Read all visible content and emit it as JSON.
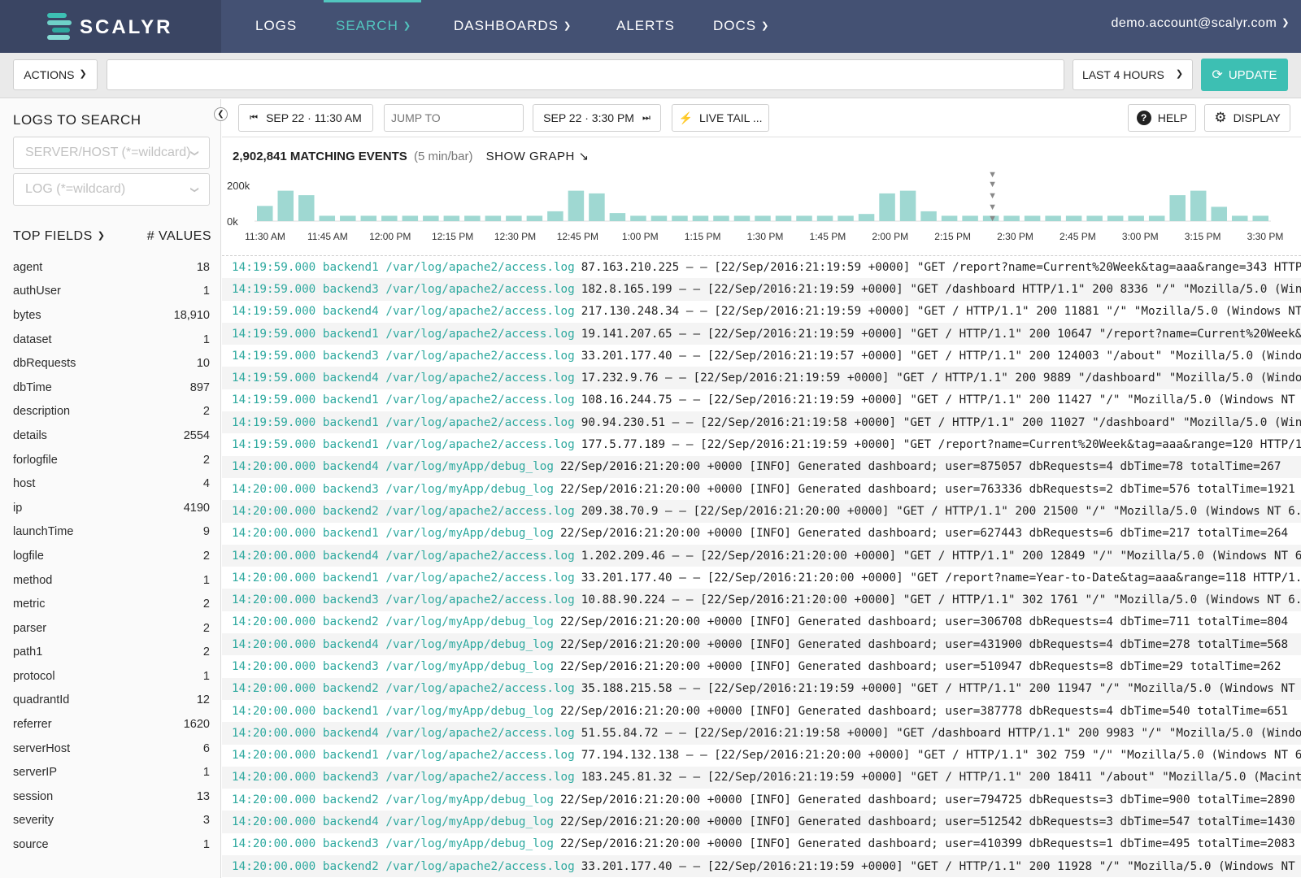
{
  "app": {
    "logo_text": "SCALYR",
    "logo_colors": [
      "#3dbfb3",
      "#6fd1c8",
      "#2ea99f",
      "#85dbd3"
    ]
  },
  "nav": {
    "items": [
      {
        "label": "LOGS",
        "active": false,
        "dropdown": false
      },
      {
        "label": "SEARCH",
        "active": true,
        "dropdown": true
      },
      {
        "label": "DASHBOARDS",
        "active": false,
        "dropdown": true
      },
      {
        "label": "ALERTS",
        "active": false,
        "dropdown": false
      },
      {
        "label": "DOCS",
        "active": false,
        "dropdown": true
      }
    ],
    "user": "demo.account@scalyr.com"
  },
  "actionbar": {
    "actions_label": "ACTIONS",
    "search_value": "",
    "time_range": "LAST 4 HOURS",
    "update_label": "UPDATE"
  },
  "sidebar": {
    "title": "LOGS TO SEARCH",
    "server_placeholder": "SERVER/HOST (*=wildcard)",
    "log_placeholder": "LOG (*=wildcard)",
    "top_fields_label": "TOP FIELDS",
    "values_label": "# VALUES",
    "fields": [
      {
        "name": "agent",
        "count": "18"
      },
      {
        "name": "authUser",
        "count": "1"
      },
      {
        "name": "bytes",
        "count": "18,910"
      },
      {
        "name": "dataset",
        "count": "1"
      },
      {
        "name": "dbRequests",
        "count": "10"
      },
      {
        "name": "dbTime",
        "count": "897"
      },
      {
        "name": "description",
        "count": "2"
      },
      {
        "name": "details",
        "count": "2554"
      },
      {
        "name": "forlogfile",
        "count": "2"
      },
      {
        "name": "host",
        "count": "4"
      },
      {
        "name": "ip",
        "count": "4190"
      },
      {
        "name": "launchTime",
        "count": "9"
      },
      {
        "name": "logfile",
        "count": "2"
      },
      {
        "name": "method",
        "count": "1"
      },
      {
        "name": "metric",
        "count": "2"
      },
      {
        "name": "parser",
        "count": "2"
      },
      {
        "name": "path1",
        "count": "2"
      },
      {
        "name": "protocol",
        "count": "1"
      },
      {
        "name": "quadrantId",
        "count": "12"
      },
      {
        "name": "referrer",
        "count": "1620"
      },
      {
        "name": "serverHost",
        "count": "6"
      },
      {
        "name": "serverIP",
        "count": "1"
      },
      {
        "name": "session",
        "count": "13"
      },
      {
        "name": "severity",
        "count": "3"
      },
      {
        "name": "source",
        "count": "1"
      }
    ]
  },
  "toolbar": {
    "start_time": "SEP 22 · 11:30 AM",
    "jump_placeholder": "JUMP TO",
    "end_time": "SEP 22 · 3:30 PM",
    "live_tail": "LIVE TAIL ...",
    "help": "HELP",
    "display": "DISPLAY"
  },
  "summary": {
    "matching": "2,902,841 MATCHING EVENTS",
    "rate": "(5 min/bar)",
    "show_graph": "SHOW GRAPH ↘"
  },
  "chart_data": {
    "type": "bar",
    "ylabel_ticks": [
      "200k",
      "0k"
    ],
    "ylim": [
      0,
      200000
    ],
    "x_tick_labels": [
      "11:30 AM",
      "11:45 AM",
      "12:00 PM",
      "12:15 PM",
      "12:30 PM",
      "12:45 PM",
      "1:00 PM",
      "1:15 PM",
      "1:30 PM",
      "1:45 PM",
      "2:00 PM",
      "2:15 PM",
      "2:30 PM",
      "2:45 PM",
      "3:00 PM",
      "3:15 PM",
      "3:30 PM"
    ],
    "bar_color": "#9fd8d2",
    "values": [
      85000,
      170000,
      145000,
      30000,
      30000,
      30000,
      30000,
      30000,
      30000,
      30000,
      30000,
      30000,
      30000,
      30000,
      55000,
      170000,
      155000,
      45000,
      30000,
      30000,
      30000,
      30000,
      30000,
      30000,
      30000,
      30000,
      30000,
      30000,
      30000,
      40000,
      155000,
      170000,
      55000,
      30000,
      30000,
      30000,
      30000,
      30000,
      30000,
      30000,
      30000,
      30000,
      30000,
      30000,
      145000,
      170000,
      80000,
      30000,
      30000
    ]
  },
  "logs": [
    {
      "prefix": "14:19:59.000 backend1 /var/log/apache2/access.log",
      "msg": "87.163.210.225 – – [22/Sep/2016:21:19:59 +0000] \"GET /report?name=Current%20Week&tag=aaa&range=343 HTTP/"
    },
    {
      "prefix": "14:19:59.000 backend3 /var/log/apache2/access.log",
      "msg": "182.8.165.199 – – [22/Sep/2016:21:19:59 +0000] \"GET /dashboard HTTP/1.1\" 200 8336 \"/\" \"Mozilla/5.0 (Wind"
    },
    {
      "prefix": "14:19:59.000 backend4 /var/log/apache2/access.log",
      "msg": "217.130.248.34 – – [22/Sep/2016:21:19:59 +0000] \"GET / HTTP/1.1\" 200 11881 \"/\" \"Mozilla/5.0 (Windows NT"
    },
    {
      "prefix": "14:19:59.000 backend1 /var/log/apache2/access.log",
      "msg": "19.141.207.65 – – [22/Sep/2016:21:19:59 +0000] \"GET / HTTP/1.1\" 200 10647 \"/report?name=Current%20Week&t"
    },
    {
      "prefix": "14:19:59.000 backend3 /var/log/apache2/access.log",
      "msg": "33.201.177.40 – – [22/Sep/2016:21:19:57 +0000] \"GET / HTTP/1.1\" 200 124003 \"/about\" \"Mozilla/5.0 (Windo"
    },
    {
      "prefix": "14:19:59.000 backend4 /var/log/apache2/access.log",
      "msg": "17.232.9.76 – – [22/Sep/2016:21:19:59 +0000] \"GET / HTTP/1.1\" 200 9889 \"/dashboard\" \"Mozilla/5.0 (Windo"
    },
    {
      "prefix": "14:19:59.000 backend1 /var/log/apache2/access.log",
      "msg": "108.16.244.75 – – [22/Sep/2016:21:19:59 +0000] \"GET / HTTP/1.1\" 200 11427 \"/\" \"Mozilla/5.0 (Windows NT 6"
    },
    {
      "prefix": "14:19:59.000 backend1 /var/log/apache2/access.log",
      "msg": "90.94.230.51 – – [22/Sep/2016:21:19:58 +0000] \"GET / HTTP/1.1\" 200 11027 \"/dashboard\" \"Mozilla/5.0 (Win"
    },
    {
      "prefix": "14:19:59.000 backend1 /var/log/apache2/access.log",
      "msg": "177.5.77.189 – – [22/Sep/2016:21:19:59 +0000] \"GET /report?name=Current%20Week&tag=aaa&range=120 HTTP/1."
    },
    {
      "prefix": "14:20:00.000 backend4 /var/log/myApp/debug_log",
      "msg": "22/Sep/2016:21:20:00 +0000 [INFO] Generated dashboard; user=875057 dbRequests=4 dbTime=78 totalTime=267"
    },
    {
      "prefix": "14:20:00.000 backend3 /var/log/myApp/debug_log",
      "msg": "22/Sep/2016:21:20:00 +0000 [INFO] Generated dashboard; user=763336 dbRequests=2 dbTime=576 totalTime=1921"
    },
    {
      "prefix": "14:20:00.000 backend2 /var/log/apache2/access.log",
      "msg": "209.38.70.9 – – [22/Sep/2016:21:20:00 +0000] \"GET / HTTP/1.1\" 200 21500 \"/\" \"Mozilla/5.0 (Windows NT 6.1"
    },
    {
      "prefix": "14:20:00.000 backend1 /var/log/myApp/debug_log",
      "msg": "22/Sep/2016:21:20:00 +0000 [INFO] Generated dashboard; user=627443 dbRequests=6 dbTime=217 totalTime=264"
    },
    {
      "prefix": "14:20:00.000 backend4 /var/log/apache2/access.log",
      "msg": "1.202.209.46 – – [22/Sep/2016:21:20:00 +0000] \"GET / HTTP/1.1\" 200 12849 \"/\" \"Mozilla/5.0 (Windows NT 6."
    },
    {
      "prefix": "14:20:00.000 backend1 /var/log/apache2/access.log",
      "msg": "33.201.177.40 – – [22/Sep/2016:21:20:00 +0000] \"GET /report?name=Year-to-Date&tag=aaa&range=118 HTTP/1.1"
    },
    {
      "prefix": "14:20:00.000 backend3 /var/log/apache2/access.log",
      "msg": "10.88.90.224 – – [22/Sep/2016:21:20:00 +0000] \"GET / HTTP/1.1\" 302 1761 \"/\" \"Mozilla/5.0 (Windows NT 6.1"
    },
    {
      "prefix": "14:20:00.000 backend2 /var/log/myApp/debug_log",
      "msg": "22/Sep/2016:21:20:00 +0000 [INFO] Generated dashboard; user=306708 dbRequests=4 dbTime=711 totalTime=804"
    },
    {
      "prefix": "14:20:00.000 backend4 /var/log/myApp/debug_log",
      "msg": "22/Sep/2016:21:20:00 +0000 [INFO] Generated dashboard; user=431900 dbRequests=4 dbTime=278 totalTime=568"
    },
    {
      "prefix": "14:20:00.000 backend3 /var/log/myApp/debug_log",
      "msg": "22/Sep/2016:21:20:00 +0000 [INFO] Generated dashboard; user=510947 dbRequests=8 dbTime=29 totalTime=262"
    },
    {
      "prefix": "14:20:00.000 backend2 /var/log/apache2/access.log",
      "msg": "35.188.215.58 – – [22/Sep/2016:21:19:59 +0000] \"GET / HTTP/1.1\" 200 11947 \"/\" \"Mozilla/5.0 (Windows NT 6"
    },
    {
      "prefix": "14:20:00.000 backend1 /var/log/myApp/debug_log",
      "msg": "22/Sep/2016:21:20:00 +0000 [INFO] Generated dashboard; user=387778 dbRequests=4 dbTime=540 totalTime=651"
    },
    {
      "prefix": "14:20:00.000 backend4 /var/log/apache2/access.log",
      "msg": "51.55.84.72 – – [22/Sep/2016:21:19:58 +0000] \"GET /dashboard HTTP/1.1\" 200 9983 \"/\" \"Mozilla/5.0 (Windo"
    },
    {
      "prefix": "14:20:00.000 backend1 /var/log/apache2/access.log",
      "msg": "77.194.132.138 – – [22/Sep/2016:21:20:00 +0000] \"GET / HTTP/1.1\" 302 759 \"/\" \"Mozilla/5.0 (Windows NT 6."
    },
    {
      "prefix": "14:20:00.000 backend3 /var/log/apache2/access.log",
      "msg": "183.245.81.32 – – [22/Sep/2016:21:19:59 +0000] \"GET / HTTP/1.1\" 200 18411 \"/about\" \"Mozilla/5.0 (Macinto"
    },
    {
      "prefix": "14:20:00.000 backend2 /var/log/myApp/debug_log",
      "msg": "22/Sep/2016:21:20:00 +0000 [INFO] Generated dashboard; user=794725 dbRequests=3 dbTime=900 totalTime=2890"
    },
    {
      "prefix": "14:20:00.000 backend4 /var/log/myApp/debug_log",
      "msg": "22/Sep/2016:21:20:00 +0000 [INFO] Generated dashboard; user=512542 dbRequests=3 dbTime=547 totalTime=1430"
    },
    {
      "prefix": "14:20:00.000 backend3 /var/log/myApp/debug_log",
      "msg": "22/Sep/2016:21:20:00 +0000 [INFO] Generated dashboard; user=410399 dbRequests=1 dbTime=495 totalTime=2083"
    },
    {
      "prefix": "14:20:00.000 backend2 /var/log/apache2/access.log",
      "msg": "33.201.177.40 – – [22/Sep/2016:21:19:59 +0000] \"GET / HTTP/1.1\" 200 11928 \"/\" \"Mozilla/5.0 (Windows NT 6."
    }
  ]
}
